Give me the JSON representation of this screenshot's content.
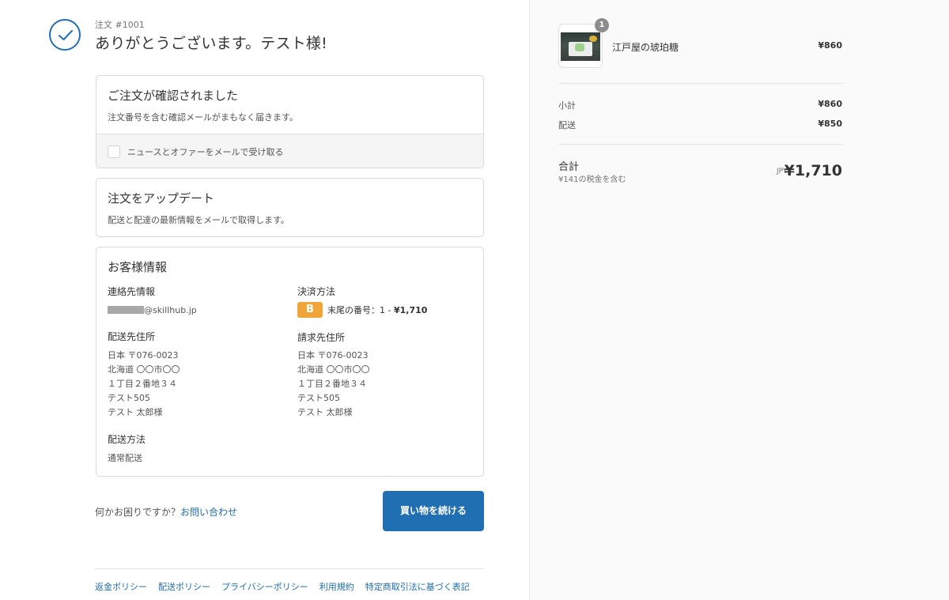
{
  "header": {
    "order_number": "注文 #1001",
    "thanks": "ありがとうございます。テスト様!"
  },
  "confirmation": {
    "title": "ご注文が確認されました",
    "subtitle": "注文番号を含む確認メールがまもなく届きます。",
    "newsletter_label": "ニュースとオファーをメールで受け取る",
    "newsletter_checked": false
  },
  "updates": {
    "title": "注文をアップデート",
    "subtitle": "配送と配達の最新情報をメールで取得します。"
  },
  "customer": {
    "title": "お客様情報",
    "contact_title": "連絡先情報",
    "contact_email": "@skillhub.jp",
    "payment_title": "決済方法",
    "payment_badge": "B",
    "payment_text": "末尾の番号：1 - ",
    "payment_amount": "¥1,710",
    "shipping_title": "配送先住所",
    "shipping_address": [
      "日本 〒076-0023",
      "北海道 〇〇市〇〇",
      "１丁目２番地３４",
      "テスト505",
      "テスト 太郎様"
    ],
    "billing_title": "請求先住所",
    "billing_address": [
      "日本 〒076-0023",
      "北海道 〇〇市〇〇",
      "１丁目２番地３４",
      "テスト505",
      "テスト 太郎様"
    ],
    "method_title": "配送方法",
    "method_value": "通常配送"
  },
  "help": {
    "text": "何かお困りですか？",
    "link": "お問い合わせ"
  },
  "continue_label": "買い物を続ける",
  "footer_links": [
    "返金ポリシー",
    "配送ポリシー",
    "プライバシーポリシー",
    "利用規約",
    "特定商取引法に基づく表記"
  ],
  "summary": {
    "qty": "1",
    "product_name": "江戸屋の琥珀糖",
    "product_price": "¥860",
    "subtotal_label": "小計",
    "subtotal_value": "¥860",
    "shipping_label": "配送",
    "shipping_value": "¥850",
    "total_label": "合計",
    "tax_note": "¥141の税金を含む",
    "currency": "JPY",
    "total_value": "¥1,710"
  },
  "colors": {
    "accent": "#1f6fb2",
    "payment_badge": "#f0a53a"
  }
}
